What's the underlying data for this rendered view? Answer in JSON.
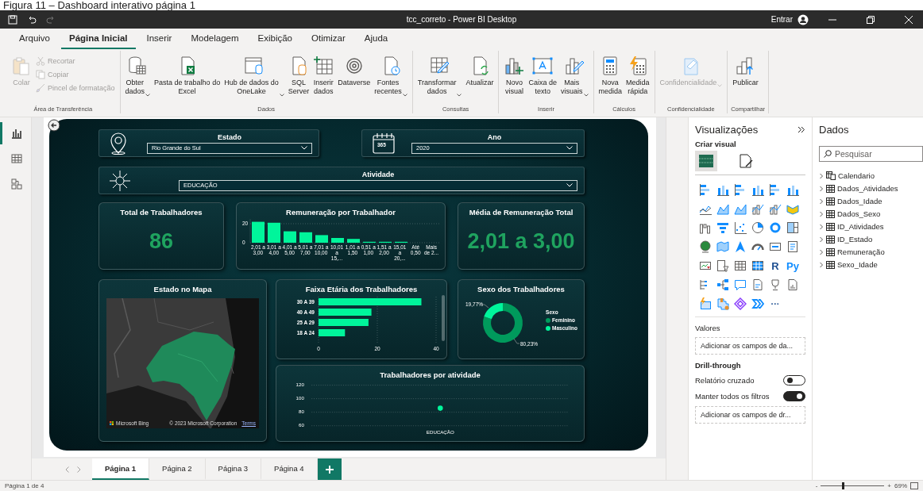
{
  "caption": "Figura 11 – Dashboard interativo página 1",
  "window": {
    "title": "tcc_correto - Power BI Desktop",
    "sign_in": "Entrar",
    "redo_disabled": true
  },
  "menu_tabs": [
    {
      "label": "Arquivo",
      "selected": false
    },
    {
      "label": "Página Inicial",
      "selected": true
    },
    {
      "label": "Inserir",
      "selected": false
    },
    {
      "label": "Modelagem",
      "selected": false
    },
    {
      "label": "Exibição",
      "selected": false
    },
    {
      "label": "Otimizar",
      "selected": false
    },
    {
      "label": "Ajuda",
      "selected": false
    }
  ],
  "ribbon": [
    {
      "group": "Área de Transferência",
      "buttons": [
        {
          "label": "Colar",
          "kind": "large",
          "disabled": true,
          "dropdown": false
        },
        {
          "label": "Recortar",
          "kind": "small",
          "disabled": true,
          "dropdown": false
        },
        {
          "label": "Copiar",
          "kind": "small",
          "disabled": true,
          "dropdown": false
        },
        {
          "label": "Pincel de formatação",
          "kind": "small",
          "disabled": true,
          "dropdown": false
        }
      ]
    },
    {
      "group": "Dados",
      "buttons": [
        {
          "label": "Obter\ndados",
          "kind": "large",
          "disabled": false,
          "dropdown": true
        },
        {
          "label": "Pasta de trabalho do\nExcel",
          "kind": "large",
          "disabled": false,
          "dropdown": false
        },
        {
          "label": "Hub de dados do\nOneLake",
          "kind": "large",
          "disabled": false,
          "dropdown": true
        },
        {
          "label": "SQL\nServer",
          "kind": "large",
          "disabled": false,
          "dropdown": false
        },
        {
          "label": "Inserir\ndados",
          "kind": "large",
          "disabled": false,
          "dropdown": false
        },
        {
          "label": "Dataverse",
          "kind": "large",
          "disabled": false,
          "dropdown": false
        },
        {
          "label": "Fontes\nrecentes",
          "kind": "large",
          "disabled": false,
          "dropdown": true
        }
      ]
    },
    {
      "group": "Consultas",
      "buttons": [
        {
          "label": "Transformar\ndados",
          "kind": "large",
          "disabled": false,
          "dropdown": true
        },
        {
          "label": "Atualizar",
          "kind": "large",
          "disabled": false,
          "dropdown": false
        }
      ]
    },
    {
      "group": "Inserir",
      "buttons": [
        {
          "label": "Novo\nvisual",
          "kind": "large",
          "disabled": false,
          "dropdown": false
        },
        {
          "label": "Caixa de\ntexto",
          "kind": "large",
          "disabled": false,
          "dropdown": false
        },
        {
          "label": "Mais\nvisuais",
          "kind": "large",
          "disabled": false,
          "dropdown": true
        }
      ]
    },
    {
      "group": "Cálculos",
      "buttons": [
        {
          "label": "Nova\nmedida",
          "kind": "large",
          "disabled": false,
          "dropdown": false
        },
        {
          "label": "Medida\nrápida",
          "kind": "large",
          "disabled": false,
          "dropdown": false
        }
      ]
    },
    {
      "group": "Confidencialidade",
      "buttons": [
        {
          "label": "Confidencialidade",
          "kind": "large",
          "disabled": true,
          "dropdown": true
        }
      ]
    },
    {
      "group": "Compartilhar",
      "buttons": [
        {
          "label": "Publicar",
          "kind": "large",
          "disabled": false,
          "dropdown": false
        }
      ]
    }
  ],
  "left_rail": [
    {
      "selected": true
    },
    {
      "selected": false
    },
    {
      "selected": false
    }
  ],
  "dashboard": {
    "slicers": [
      {
        "title": "Estado",
        "value": "Rio Grande do Sul"
      },
      {
        "title": "Ano",
        "value": "2020",
        "icon_text": "365"
      },
      {
        "title": "Atividade",
        "value": "EDUCAÇÃO"
      }
    ],
    "cards": [
      {
        "title": "Total de Trabalhadores",
        "value": "86"
      },
      {
        "title": "Média de Remuneração Total",
        "value": "2,01 a 3,00"
      }
    ],
    "remuneracao": {
      "title": "Remuneração por Trabalhador",
      "chart_data": {
        "type": "bar",
        "categories": [
          "2,01 a 3,00",
          "3,01 a 4,00",
          "4,01 a 5,00",
          "5,01 a 7,00",
          "7,01 a 10,00",
          "10,01 a 15,...",
          "1,01 a 1,50",
          "0,51 a 1,00",
          "1,51 a 2,00",
          "15,01 a 20,...",
          "Até 0,50",
          "Mais de 2..."
        ],
        "values": [
          22,
          21,
          12,
          11,
          8,
          5,
          4,
          1,
          1,
          1,
          0,
          0
        ],
        "ylim": [
          0,
          25
        ],
        "yticks": [
          0,
          20
        ]
      }
    },
    "mapa": {
      "title": "Estado no Mapa",
      "provider": "Microsoft Bing",
      "attribution": "© 2023 Microsoft Corporation",
      "terms": "Terms"
    },
    "faixa": {
      "title": "Faixa Etária dos Trabalhadores",
      "chart_data": {
        "type": "bar",
        "orientation": "horizontal",
        "categories": [
          "30 A 39",
          "40 A 49",
          "25 A 29",
          "18 A 24"
        ],
        "values": [
          35,
          18,
          17,
          9
        ],
        "xlim": [
          0,
          40
        ],
        "xticks": [
          0,
          20,
          40
        ]
      }
    },
    "sexo": {
      "title": "Sexo dos Trabalhadores",
      "legend_title": "Sexo",
      "legend": [
        {
          "color": "#009a5c"
        },
        {
          "color": "#00f59b"
        }
      ],
      "chart_data": {
        "type": "donut",
        "categories": [
          "Feminino",
          "Masculino"
        ],
        "values": [
          80.23,
          19.77
        ],
        "value_labels": [
          "80,23%",
          "19,77%"
        ]
      }
    },
    "atividade": {
      "title": "Trabalhadores por atividade",
      "chart_data": {
        "type": "scatter",
        "categories": [
          "EDUCAÇÃO"
        ],
        "values": [
          86
        ],
        "ylim": [
          60,
          120
        ],
        "yticks": [
          60,
          80,
          100,
          120
        ]
      }
    }
  },
  "visualizations": {
    "title": "Visualizações",
    "subtitle": "Criar visual",
    "build_tabs": [
      {
        "selected": true
      },
      {
        "selected": false
      }
    ],
    "gallery_labels": [
      "R",
      "Py",
      "···"
    ],
    "values_label": "Valores",
    "values_well": "Adicionar os campos de da...",
    "drill_label": "Drill-through",
    "toggles": [
      {
        "label": "Relatório cruzado",
        "on": false
      },
      {
        "label": "Manter todos os filtros",
        "on": true
      }
    ],
    "drill_well": "Adicionar os campos de dr..."
  },
  "data_pane": {
    "title": "Dados",
    "search": {
      "placeholder": "Pesquisar"
    },
    "tables": [
      {
        "name": "Calendario",
        "kind": "date-table",
        "expanded": false
      },
      {
        "name": "Dados_Atividades",
        "kind": "table",
        "expanded": false
      },
      {
        "name": "Dados_Idade",
        "kind": "table",
        "expanded": false
      },
      {
        "name": "Dados_Sexo",
        "kind": "table",
        "expanded": false
      },
      {
        "name": "ID_Atividades",
        "kind": "table",
        "expanded": false
      },
      {
        "name": "ID_Estado",
        "kind": "table",
        "expanded": false
      },
      {
        "name": "Remuneração",
        "kind": "table",
        "expanded": false
      },
      {
        "name": "Sexo_Idade",
        "kind": "table",
        "expanded": false
      }
    ]
  },
  "pages": [
    {
      "label": "Página 1",
      "selected": true
    },
    {
      "label": "Página 2",
      "selected": false
    },
    {
      "label": "Página 3",
      "selected": false
    },
    {
      "label": "Página 4",
      "selected": false
    }
  ],
  "status": {
    "page": "Página 1 de 4",
    "zoom_minus": "-",
    "zoom_plus": "+",
    "zoom_slider": {
      "level": 0.35
    },
    "zoom": "69%"
  }
}
